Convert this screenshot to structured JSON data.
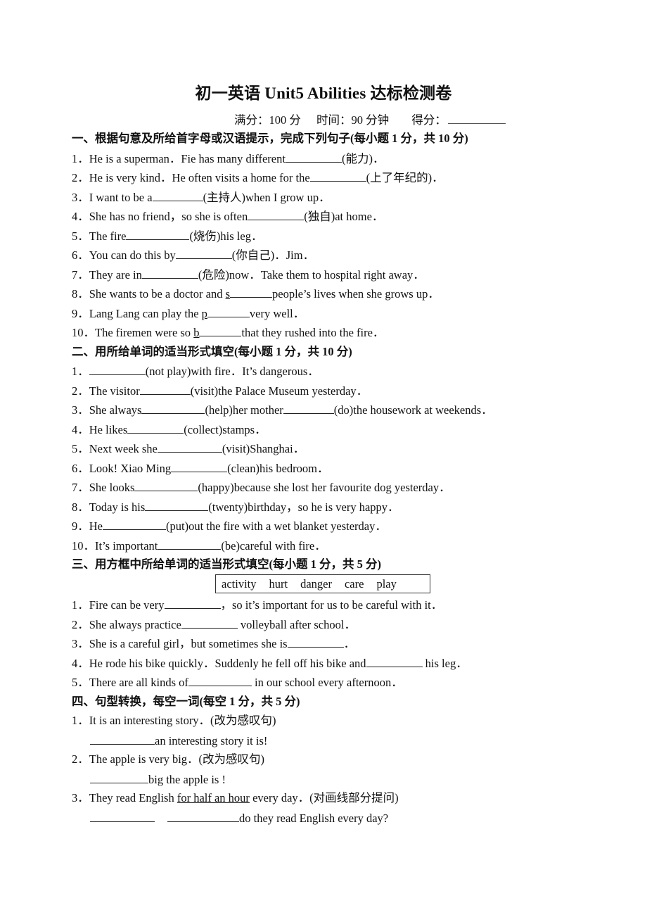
{
  "document": {
    "title": "初一英语 Unit5 Abilities 达标检测卷",
    "meta": {
      "full_score": "满分：100 分",
      "time": "时间：90 分钟",
      "score_label": "得分："
    }
  },
  "sections": [
    {
      "heading": "一、根据句意及所给首字母或汉语提示，完成下列句子(每小题 1 分，共 10 分)",
      "items": [
        {
          "num": "1．",
          "before": "He is a superman．Fie has many different",
          "after": "(能力)．"
        },
        {
          "num": "2．",
          "before": "He is very kind．He often visits a home for the",
          "after": "(上了年纪的)．"
        },
        {
          "num": "3．",
          "before": "I want to be a",
          "after": "(主持人)when I grow up．"
        },
        {
          "num": "4．",
          "before": "She has no friend，so she is often",
          "after": "(独自)at home．"
        },
        {
          "num": "5．",
          "before": "The fire",
          "after": "(烧伤)his leg．"
        },
        {
          "num": "6．",
          "before": "You can do this by",
          "after": "(你自己)．Jim．"
        },
        {
          "num": "7．",
          "before": "They are in",
          "after": "(危险)now．Take them to hospital right away．"
        },
        {
          "num": "8．",
          "before": "She wants to be a doctor and ",
          "letter": "s",
          "after": "people’s lives when she grows up．"
        },
        {
          "num": "9．",
          "before": "Lang Lang can play the ",
          "letter": "p",
          "after": "very well．"
        },
        {
          "num": "10．",
          "before": "The firemen were so ",
          "letter": "b",
          "after": "that they rushed into the fire．"
        }
      ]
    },
    {
      "heading": "二、用所给单词的适当形式填空(每小题 1 分，共 10 分)",
      "items": [
        {
          "num": "1．",
          "before": "",
          "after": "(not play)with fire．It’s dangerous．"
        },
        {
          "num": "2．",
          "before": "The visitor",
          "after": "(visit)the Palace Museum yesterday．"
        },
        {
          "num": "3．",
          "before": "She always",
          "middle": "(help)her mother",
          "after": "(do)the housework at weekends．"
        },
        {
          "num": "4．",
          "before": "He likes",
          "after": "(collect)stamps．"
        },
        {
          "num": "5．",
          "before": "Next week she",
          "after": "(visit)Shanghai．"
        },
        {
          "num": "6．",
          "before": "Look! Xiao Ming",
          "after": "(clean)his bedroom．"
        },
        {
          "num": "7．",
          "before": "She looks",
          "after": "(happy)because she lost her favourite dog yesterday．"
        },
        {
          "num": "8．",
          "before": "Today is his",
          "after": "(twenty)birthday，so he is very happy．"
        },
        {
          "num": "9．",
          "before": "He",
          "after": "(put)out the fire with a wet blanket yesterday．"
        },
        {
          "num": "10．",
          "before": "It’s important",
          "after": "(be)careful with fire．"
        }
      ]
    },
    {
      "heading": "三、用方框中所给单词的适当形式填空(每小题 1 分，共 5 分)",
      "word_box": [
        "activity",
        "hurt",
        "danger",
        "care",
        "play"
      ],
      "items": [
        {
          "num": "1．",
          "before": "Fire can be very",
          "after": "，so it’s important for us to be careful with it．"
        },
        {
          "num": "2．",
          "before": "She always practice",
          "after": " volleyball after school．"
        },
        {
          "num": "3．",
          "before": "She is a careful girl，but sometimes she is",
          "after": "．"
        },
        {
          "num": "4．",
          "before": "He rode his bike quickly．Suddenly he fell off his bike and",
          "after": " his leg．"
        },
        {
          "num": "5．",
          "before": "There are all kinds of",
          "after": " in our school every afternoon．"
        }
      ]
    },
    {
      "heading": "四、句型转换，每空一词(每空 1 分，共 5 分)",
      "items": [
        {
          "num": "1．",
          "prompt": "It is an interesting story．(改为感叹句)",
          "answer_after": "an interesting story it is!"
        },
        {
          "num": "2．",
          "prompt": "The apple is very big．(改为感叹句)",
          "answer_after": "big the apple is !"
        },
        {
          "num": "3．",
          "prompt_before": "They read English ",
          "prompt_underlined": "for half an hour",
          "prompt_after": " every day．(对画线部分提问)",
          "answer_after": "do they read English every day?"
        }
      ]
    }
  ]
}
